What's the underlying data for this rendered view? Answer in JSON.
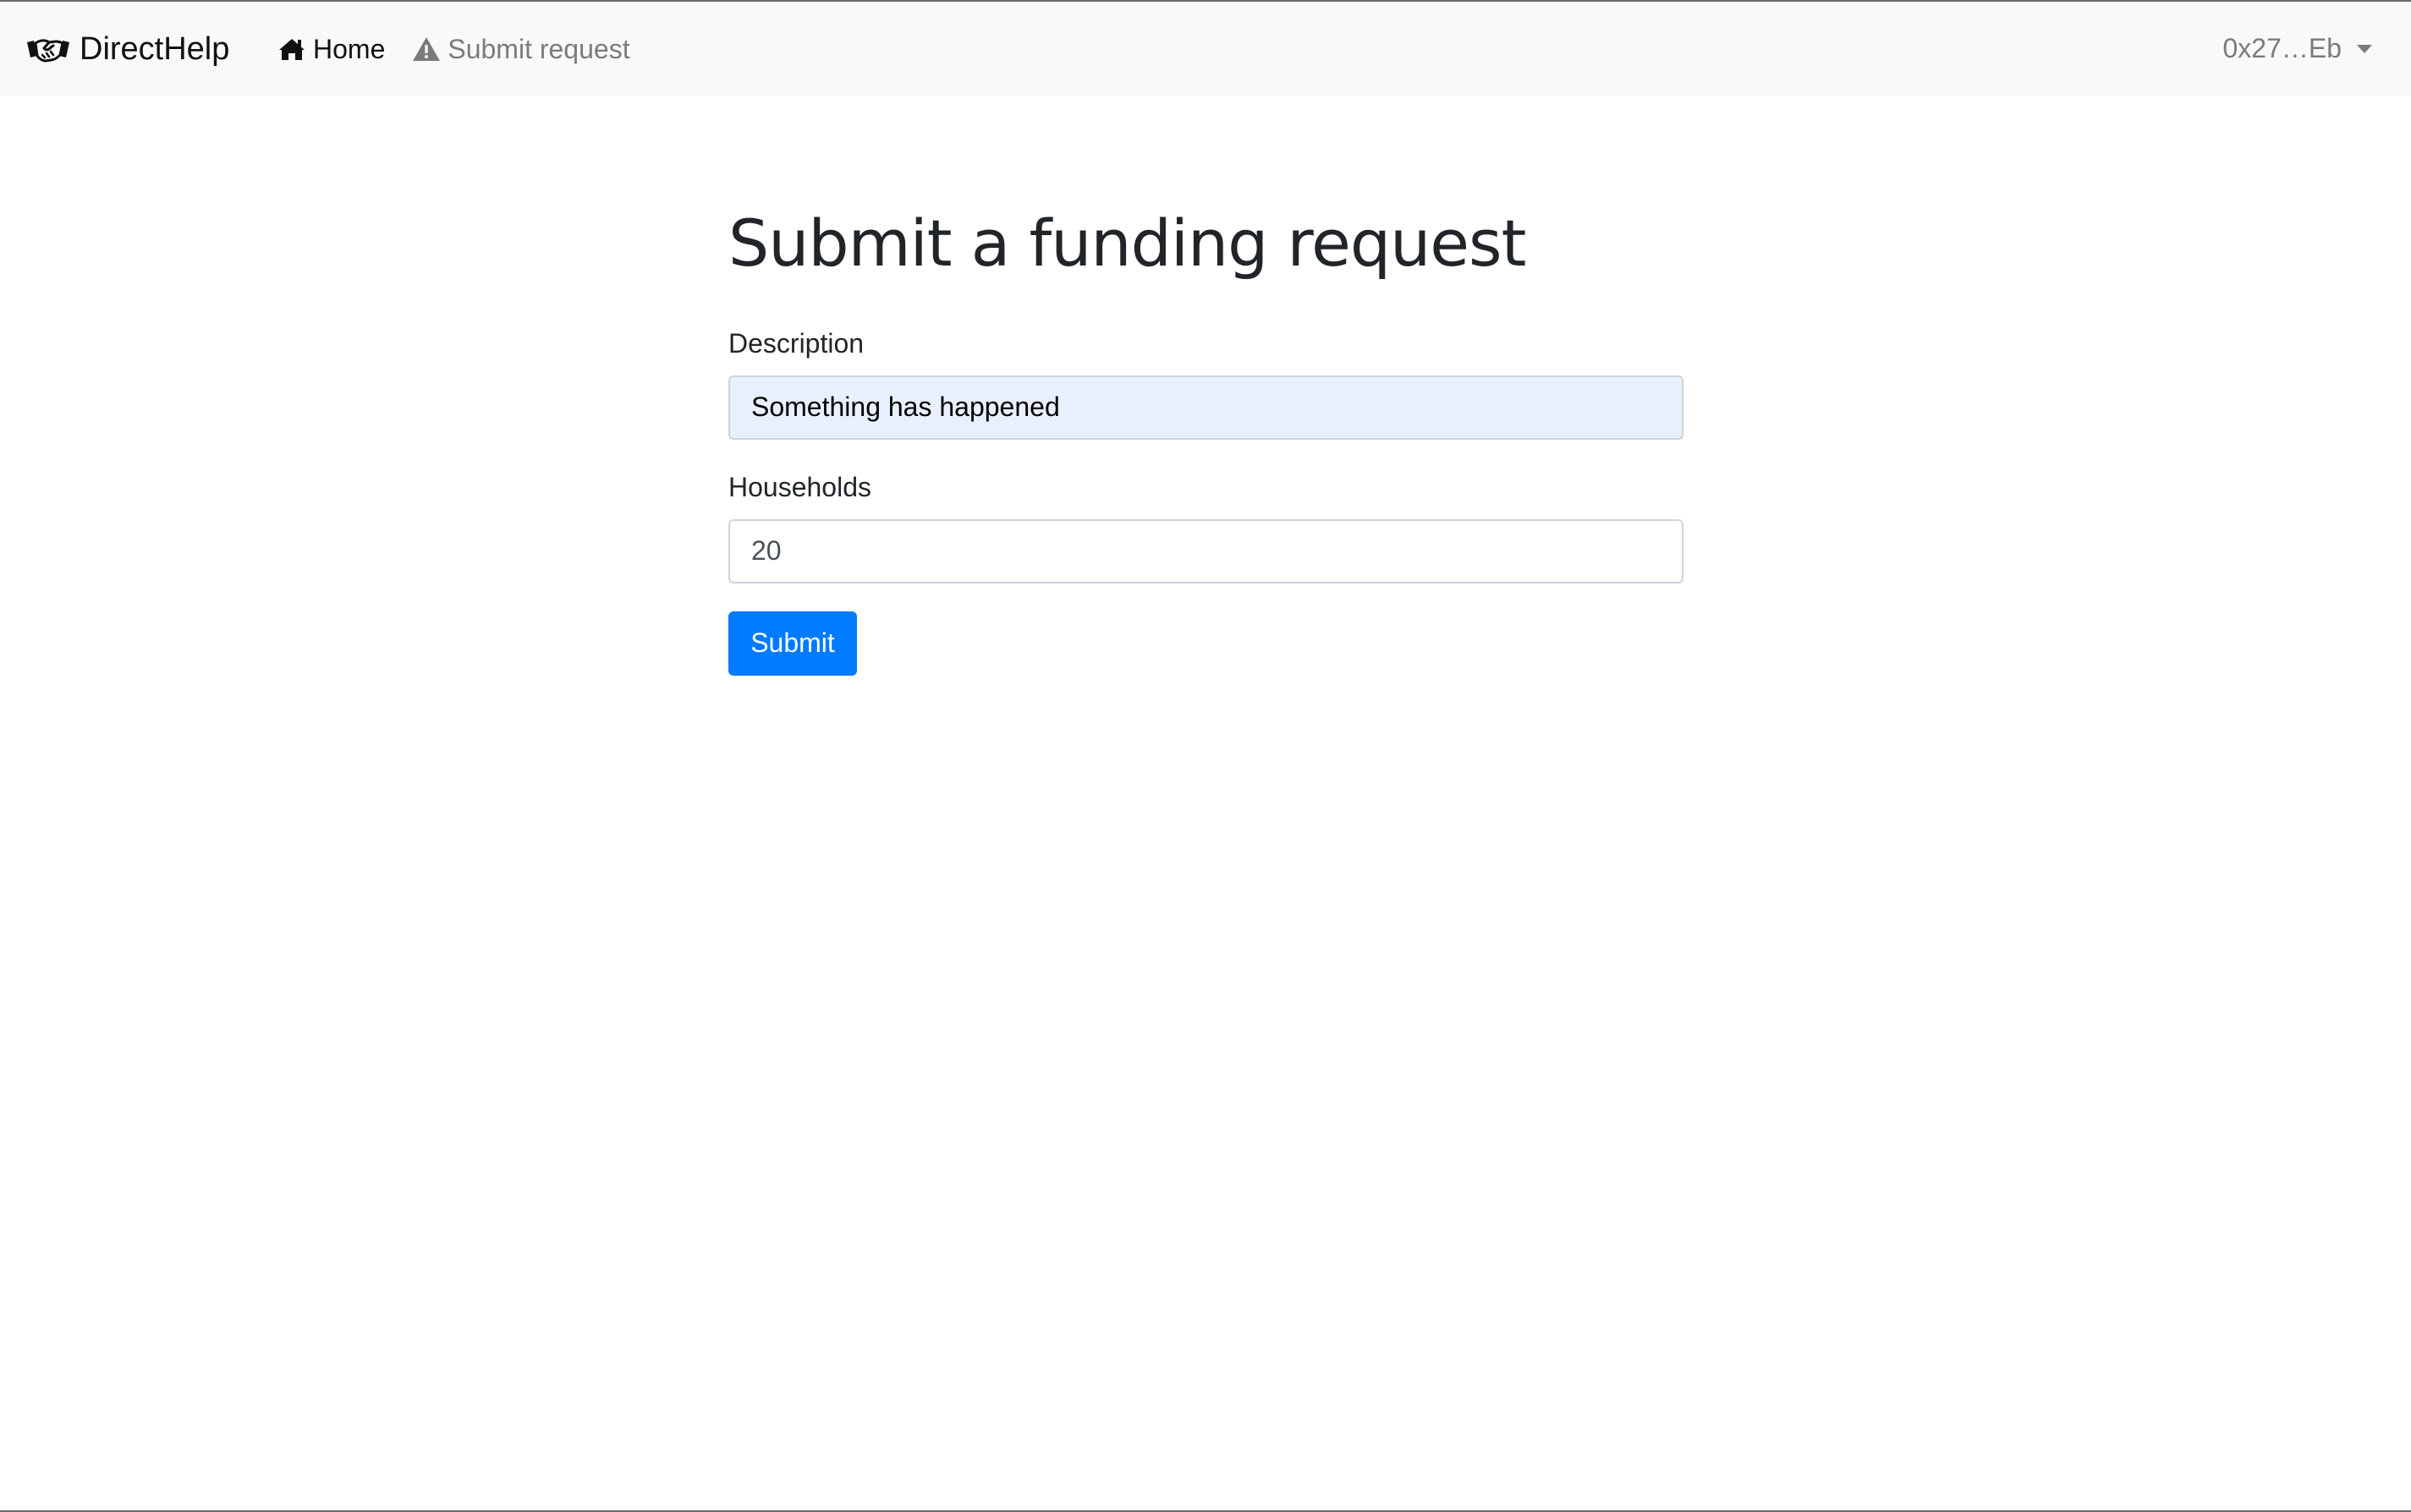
{
  "navbar": {
    "brand": {
      "text": "DirectHelp",
      "icon": "handshake-icon"
    },
    "links": [
      {
        "label": "Home",
        "icon": "home-icon",
        "active": true
      },
      {
        "label": "Submit request",
        "icon": "warning-icon",
        "active": false
      }
    ],
    "account": {
      "label": "0x27…Eb",
      "icon": "caret-down-icon"
    }
  },
  "main": {
    "title": "Submit a funding request",
    "description": {
      "label": "Description",
      "value": "Something has happened"
    },
    "households": {
      "label": "Households",
      "value": "20"
    },
    "submit_label": "Submit"
  },
  "colors": {
    "navbar_bg": "#f8f9fa",
    "primary": "#007bff",
    "autofill_bg": "#e8f0fe",
    "muted_text": "#7a7b7c"
  }
}
